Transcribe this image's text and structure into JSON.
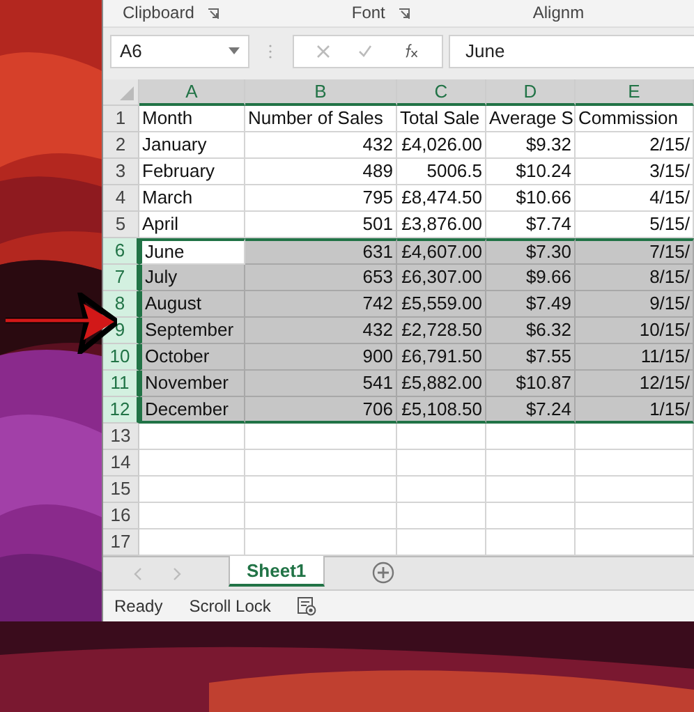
{
  "ribbon": {
    "groups": [
      "Clipboard",
      "Font",
      "Alignm"
    ]
  },
  "formula_bar": {
    "name_box": "A6",
    "value": "June"
  },
  "columns": [
    {
      "label": "A",
      "selected": true
    },
    {
      "label": "B",
      "selected": true
    },
    {
      "label": "C",
      "selected": true
    },
    {
      "label": "D",
      "selected": true
    },
    {
      "label": "E",
      "selected": true
    }
  ],
  "rows": [
    {
      "number": "1",
      "kind": "header",
      "selected": false,
      "cells": [
        "Month",
        "Number of Sales",
        "Total Sale",
        "Average S",
        "Commission"
      ]
    },
    {
      "number": "2",
      "kind": "data",
      "selected": false,
      "cells": [
        "January",
        "432",
        "£4,026.00",
        "$9.32",
        "2/15/"
      ]
    },
    {
      "number": "3",
      "kind": "data",
      "selected": false,
      "cells": [
        "February",
        "489",
        "5006.5",
        "$10.24",
        "3/15/"
      ]
    },
    {
      "number": "4",
      "kind": "data",
      "selected": false,
      "cells": [
        "March",
        "795",
        "£8,474.50",
        "$10.66",
        "4/15/"
      ]
    },
    {
      "number": "5",
      "kind": "data",
      "selected": false,
      "cells": [
        "April",
        "501",
        "£3,876.00",
        "$7.74",
        "5/15/"
      ]
    },
    {
      "number": "6",
      "kind": "data",
      "selected": true,
      "active": true,
      "cells": [
        "June",
        "631",
        "£4,607.00",
        "$7.30",
        "7/15/"
      ]
    },
    {
      "number": "7",
      "kind": "data",
      "selected": true,
      "cells": [
        "July",
        "653",
        "£6,307.00",
        "$9.66",
        "8/15/"
      ]
    },
    {
      "number": "8",
      "kind": "data",
      "selected": true,
      "cells": [
        "August",
        "742",
        "£5,559.00",
        "$7.49",
        "9/15/"
      ]
    },
    {
      "number": "9",
      "kind": "data",
      "selected": true,
      "cells": [
        "September",
        "432",
        "£2,728.50",
        "$6.32",
        "10/15/"
      ]
    },
    {
      "number": "10",
      "kind": "data",
      "selected": true,
      "cells": [
        "October",
        "900",
        "£6,791.50",
        "$7.55",
        "11/15/"
      ]
    },
    {
      "number": "11",
      "kind": "data",
      "selected": true,
      "cells": [
        "November",
        "541",
        "£5,882.00",
        "$10.87",
        "12/15/"
      ]
    },
    {
      "number": "12",
      "kind": "data",
      "selected": true,
      "cells": [
        "December",
        "706",
        "£5,108.50",
        "$7.24",
        "1/15/"
      ]
    },
    {
      "number": "13",
      "kind": "empty",
      "selected": false
    },
    {
      "number": "14",
      "kind": "empty",
      "selected": false
    },
    {
      "number": "15",
      "kind": "empty",
      "selected": false
    },
    {
      "number": "16",
      "kind": "empty",
      "selected": false
    },
    {
      "number": "17",
      "kind": "empty",
      "selected": false
    }
  ],
  "sheet_tabs": [
    {
      "label": "Sheet1",
      "selected": true
    }
  ],
  "status_bar": [
    "Ready",
    "Scroll Lock"
  ]
}
